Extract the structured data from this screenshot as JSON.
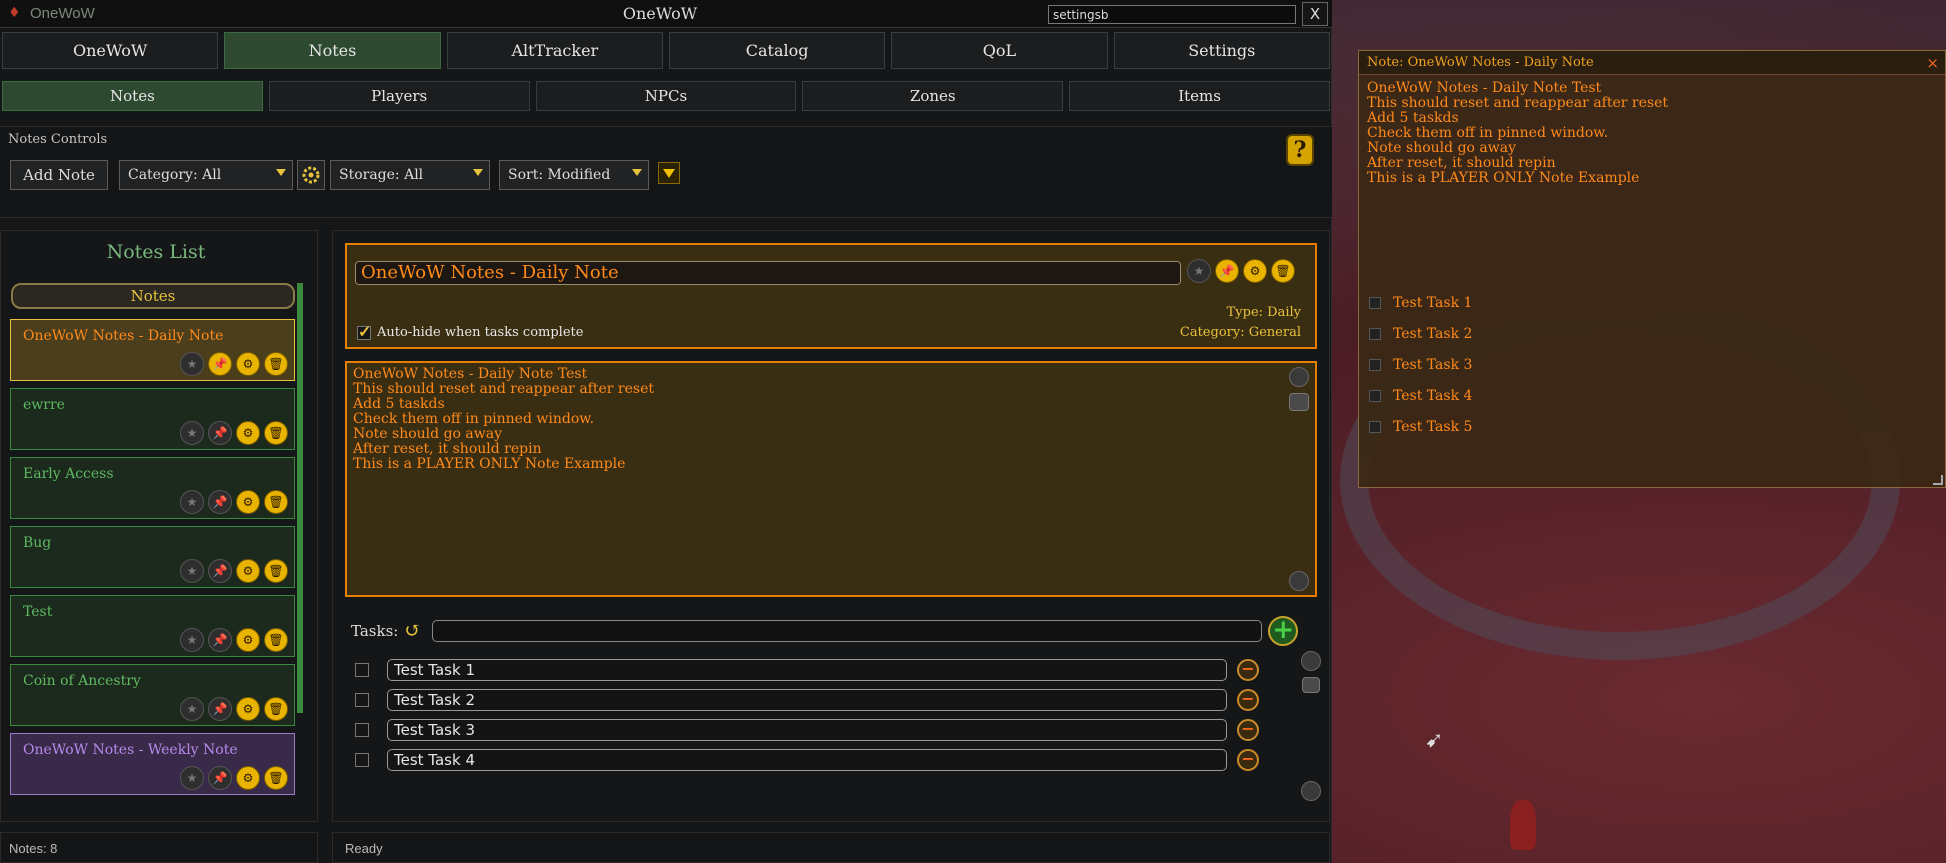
{
  "app": {
    "logo_name": "OneWoW",
    "window_title": "OneWoW",
    "search_value": "settingsb",
    "close_label": "X"
  },
  "top_tabs": [
    {
      "label": "OneWoW",
      "active": false
    },
    {
      "label": "Notes",
      "active": true
    },
    {
      "label": "AltTracker",
      "active": false
    },
    {
      "label": "Catalog",
      "active": false
    },
    {
      "label": "QoL",
      "active": false
    },
    {
      "label": "Settings",
      "active": false
    }
  ],
  "sub_tabs": [
    {
      "label": "Notes",
      "active": true
    },
    {
      "label": "Players",
      "active": false
    },
    {
      "label": "NPCs",
      "active": false
    },
    {
      "label": "Zones",
      "active": false
    },
    {
      "label": "Items",
      "active": false
    }
  ],
  "controls": {
    "section_label": "Notes Controls",
    "add_note": "Add Note",
    "category": "Category: All",
    "storage": "Storage: All",
    "sort": "Sort: Modified",
    "help": "?"
  },
  "notes_list": {
    "title": "Notes List",
    "filter_label": "Notes",
    "items": [
      {
        "name": "OneWoW Notes - Daily Note",
        "style": "selected"
      },
      {
        "name": "ewrre",
        "style": "normal"
      },
      {
        "name": "Early Access",
        "style": "normal"
      },
      {
        "name": "Bug",
        "style": "normal"
      },
      {
        "name": "Test",
        "style": "normal"
      },
      {
        "name": "Coin of Ancestry",
        "style": "normal"
      },
      {
        "name": "OneWoW Notes - Weekly Note",
        "style": "weekly"
      }
    ],
    "count_text": "Notes: 8"
  },
  "detail": {
    "title": "OneWoW Notes - Daily Note",
    "type": "Type: Daily",
    "category": "Category: General",
    "autohide_label": "Auto-hide when tasks complete",
    "autohide_checked": true,
    "body_lines": [
      "OneWoW Notes - Daily Note Test",
      "This should reset and reappear after reset",
      "Add 5 taskds",
      "Check them off in pinned window.",
      "Note should go away",
      "After reset, it should repin",
      "This is a PLAYER ONLY Note Example"
    ],
    "tasks_label": "Tasks:",
    "tasks": [
      "Test Task 1",
      "Test Task 2",
      "Test Task 3",
      "Test Task 4"
    ],
    "status": "Ready"
  },
  "pinned": {
    "title": "Note: OneWoW Notes - Daily Note",
    "close": "×",
    "lines": [
      "OneWoW Notes - Daily Note Test",
      "This should reset and reappear after reset",
      "Add 5 taskds",
      "Check them off in pinned window.",
      "Note should go away",
      "After reset, it should repin",
      "This is a PLAYER ONLY Note Example"
    ],
    "tasks": [
      "Test Task 1",
      "Test Task 2",
      "Test Task 3",
      "Test Task 4",
      "Test Task 5"
    ]
  },
  "colors": {
    "accent_green": "#2d4a30",
    "orange": "#ff8a1a",
    "gold": "#e8c23a"
  }
}
